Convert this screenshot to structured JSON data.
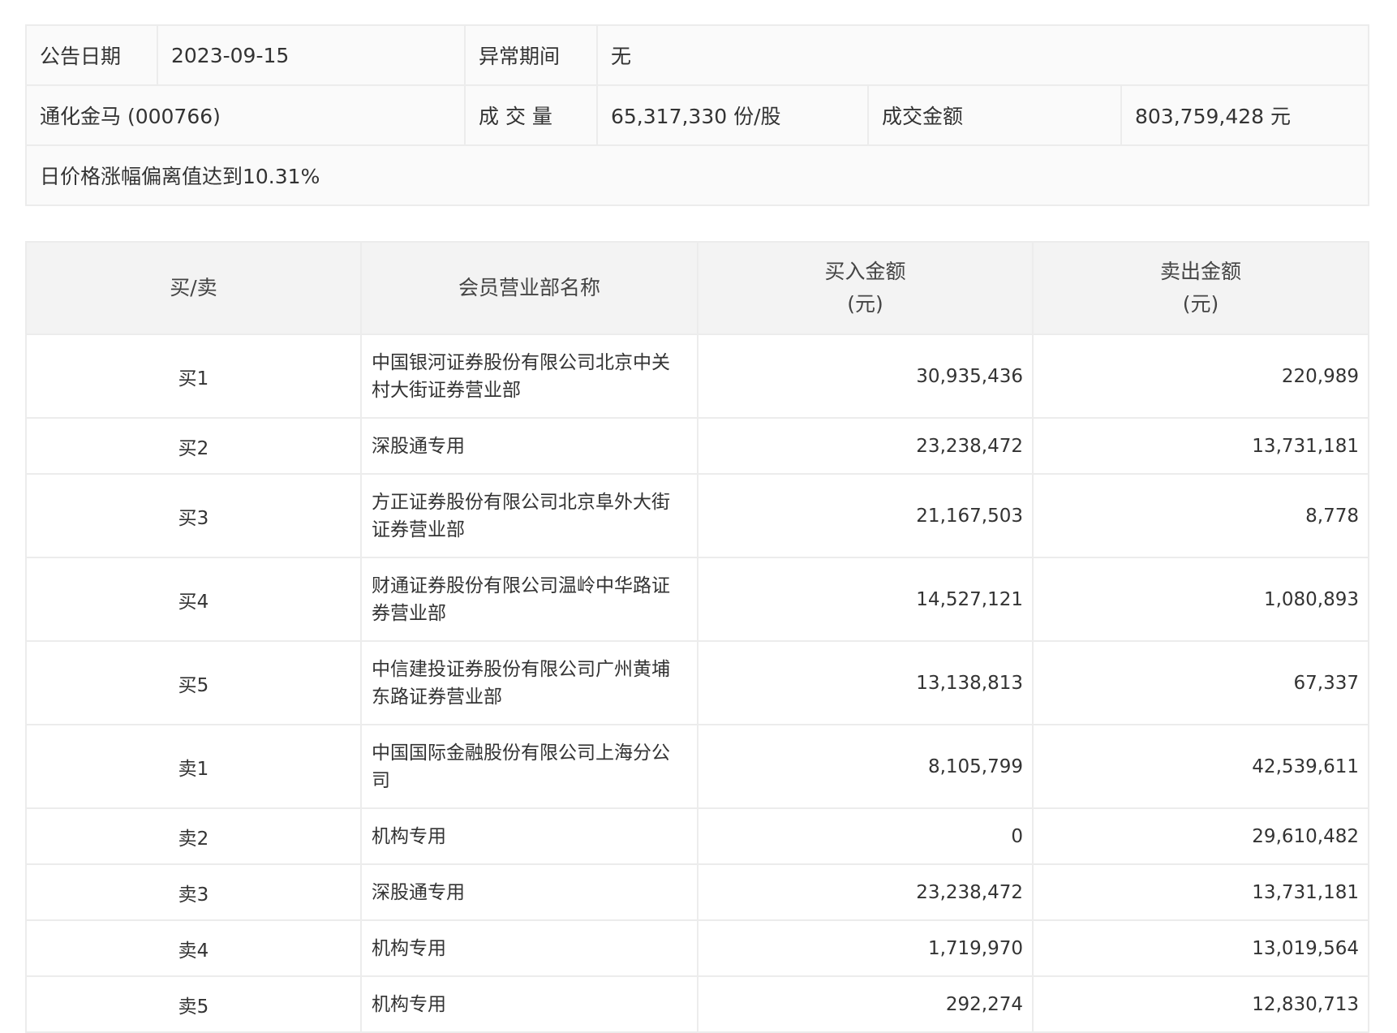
{
  "info": {
    "date_label": "公告日期",
    "date_value": "2023-09-15",
    "period_label": "异常期间",
    "period_value": "无",
    "stock": "通化金马 (000766)",
    "volume_label": "成 交 量",
    "volume_value": "65,317,330 份/股",
    "amount_label": "成交金额",
    "amount_value": "803,759,428 元",
    "reason": "日价格涨幅偏离值达到10.31%"
  },
  "table": {
    "headers": {
      "side": "买/卖",
      "name": "会员营业部名称",
      "buy": "买入金额",
      "buy_unit": "(元)",
      "sell": "卖出金额",
      "sell_unit": "(元)"
    },
    "rows": [
      {
        "side": "买1",
        "name": "中国银河证券股份有限公司北京中关村大街证券营业部",
        "buy": "30,935,436",
        "sell": "220,989"
      },
      {
        "side": "买2",
        "name": "深股通专用",
        "buy": "23,238,472",
        "sell": "13,731,181"
      },
      {
        "side": "买3",
        "name": "方正证券股份有限公司北京阜外大街证券营业部",
        "buy": "21,167,503",
        "sell": "8,778"
      },
      {
        "side": "买4",
        "name": "财通证券股份有限公司温岭中华路证券营业部",
        "buy": "14,527,121",
        "sell": "1,080,893"
      },
      {
        "side": "买5",
        "name": "中信建投证券股份有限公司广州黄埔东路证券营业部",
        "buy": "13,138,813",
        "sell": "67,337"
      },
      {
        "side": "卖1",
        "name": "中国国际金融股份有限公司上海分公司",
        "buy": "8,105,799",
        "sell": "42,539,611"
      },
      {
        "side": "卖2",
        "name": "机构专用",
        "buy": "0",
        "sell": "29,610,482"
      },
      {
        "side": "卖3",
        "name": "深股通专用",
        "buy": "23,238,472",
        "sell": "13,731,181"
      },
      {
        "side": "卖4",
        "name": "机构专用",
        "buy": "1,719,970",
        "sell": "13,019,564"
      },
      {
        "side": "卖5",
        "name": "机构专用",
        "buy": "292,274",
        "sell": "12,830,713"
      }
    ]
  }
}
